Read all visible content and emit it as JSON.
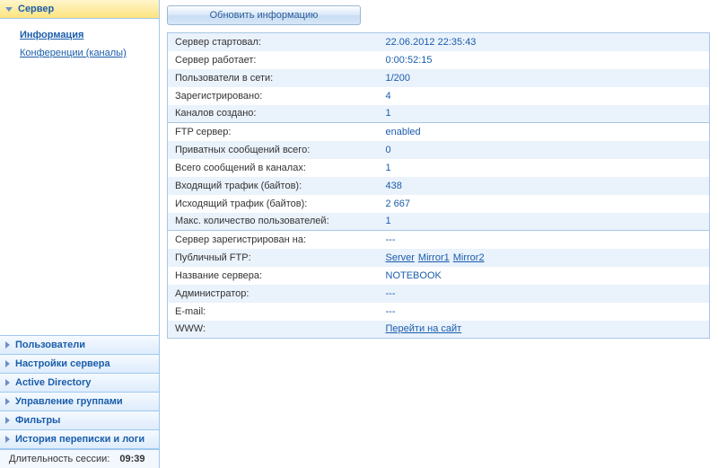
{
  "sidebar": {
    "sections": [
      {
        "label": "Сервер",
        "expanded": true
      },
      {
        "label": "Пользователи",
        "expanded": false
      },
      {
        "label": "Настройки сервера",
        "expanded": false
      },
      {
        "label": "Active Directory",
        "expanded": false
      },
      {
        "label": "Управление группами",
        "expanded": false
      },
      {
        "label": "Фильтры",
        "expanded": false
      },
      {
        "label": "История переписки и логи",
        "expanded": false
      }
    ],
    "server_nav": [
      {
        "label": "Информация",
        "selected": true
      },
      {
        "label": "Конференции (каналы)",
        "selected": false
      }
    ],
    "footer": {
      "label": "Длительность сессии:",
      "value": "09:39"
    }
  },
  "main": {
    "update_button": "Обновить информацию",
    "groups": [
      {
        "rows": [
          {
            "label": "Сервер стартовал:",
            "value": "22.06.2012 22:35:43",
            "type": "text"
          },
          {
            "label": "Сервер работает:",
            "value": "0:00:52:15",
            "type": "text"
          },
          {
            "label": "Пользователи в сети:",
            "value": "1/200",
            "type": "text"
          },
          {
            "label": "Зарегистрировано:",
            "value": "4",
            "type": "text"
          },
          {
            "label": "Каналов создано:",
            "value": "1",
            "type": "text"
          }
        ]
      },
      {
        "rows": [
          {
            "label": "FTP сервер:",
            "value": "enabled",
            "type": "text"
          },
          {
            "label": "Приватных сообщений всего:",
            "value": "0",
            "type": "text"
          },
          {
            "label": "Всего сообщений в каналах:",
            "value": "1",
            "type": "text"
          },
          {
            "label": "Входящий трафик (байтов):",
            "value": "438",
            "type": "text"
          },
          {
            "label": "Исходящий трафик (байтов):",
            "value": "2 667",
            "type": "text"
          },
          {
            "label": "Макс. количество пользователей:",
            "value": "1",
            "type": "text"
          }
        ]
      },
      {
        "rows": [
          {
            "label": "Сервер зарегистрирован на:",
            "value": "---",
            "type": "text"
          },
          {
            "label": "Публичный FTP:",
            "type": "links",
            "links": [
              "Server",
              "Mirror1",
              "Mirror2"
            ]
          },
          {
            "label": "Название сервера:",
            "value": "NOTEBOOK",
            "type": "text"
          },
          {
            "label": "Администратор:",
            "value": "---",
            "type": "text"
          },
          {
            "label": "E-mail:",
            "value": "---",
            "type": "text"
          },
          {
            "label": "WWW:",
            "type": "links",
            "links": [
              "Перейти на сайт"
            ]
          }
        ]
      }
    ]
  }
}
